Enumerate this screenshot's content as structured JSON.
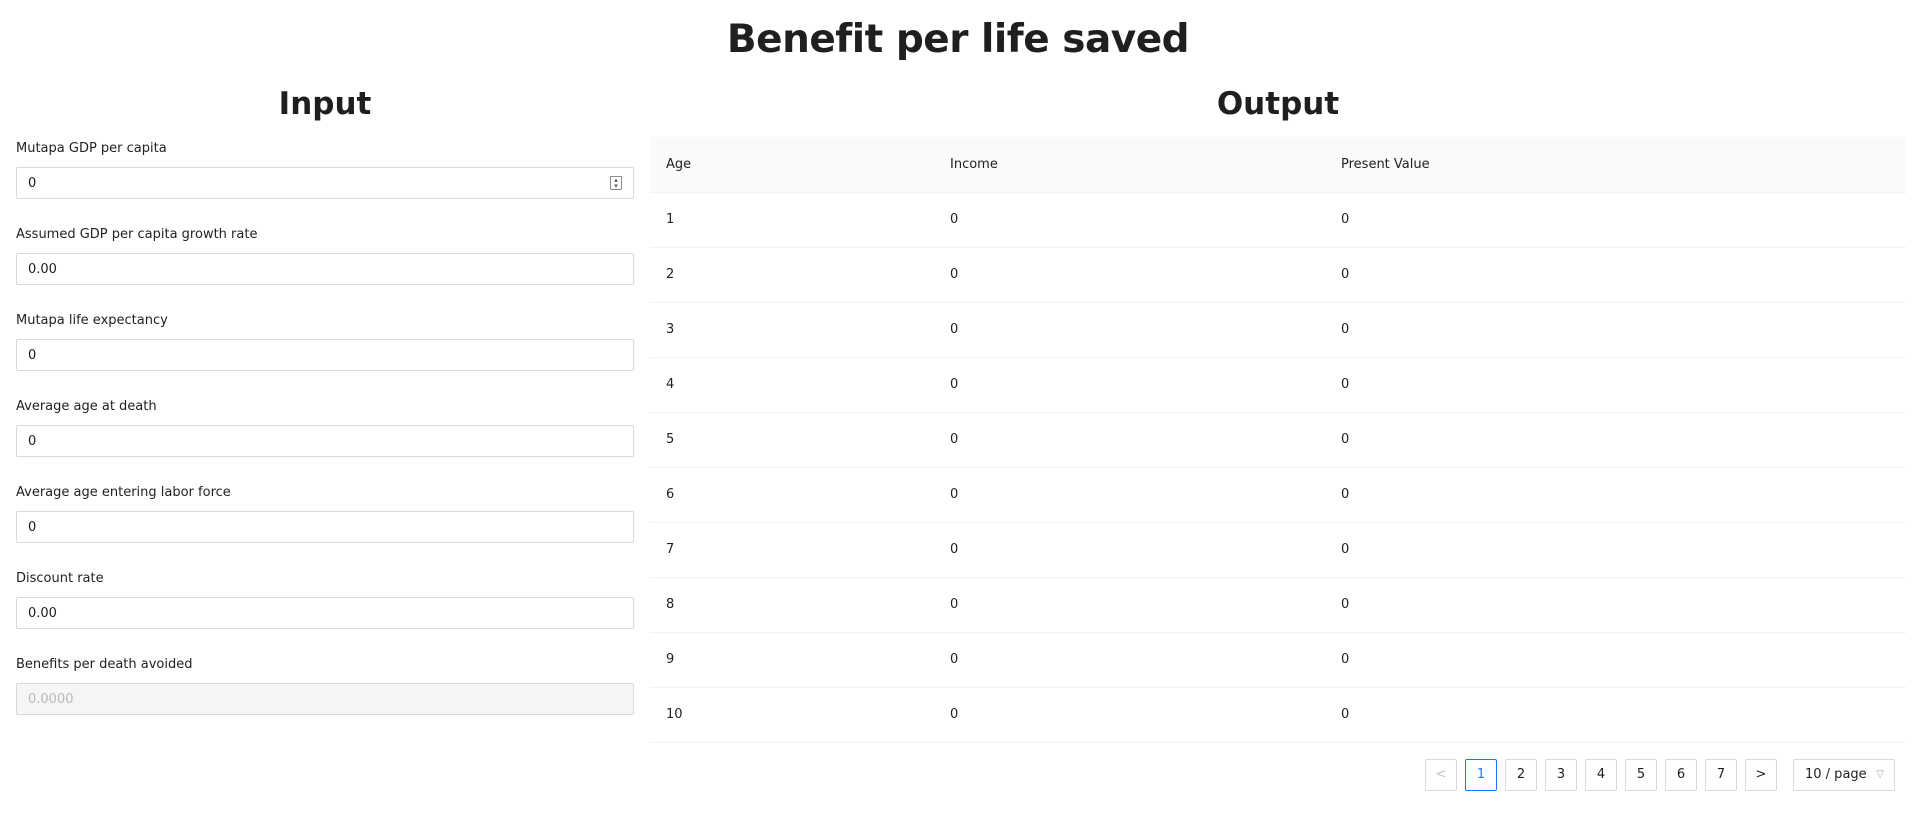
{
  "page": {
    "title": "Benefit per life saved",
    "input_title": "Input",
    "output_title": "Output"
  },
  "inputs": [
    {
      "label": "Mutapa GDP per capita",
      "value": "0",
      "icon": "number-stepper-icon",
      "disabled": false
    },
    {
      "label": "Assumed GDP per capita growth rate",
      "value": "0.00",
      "disabled": false
    },
    {
      "label": "Mutapa life expectancy",
      "value": "0",
      "disabled": false
    },
    {
      "label": "Average age at death",
      "value": "0",
      "disabled": false
    },
    {
      "label": "Average age entering labor force",
      "value": "0",
      "disabled": false
    },
    {
      "label": "Discount rate",
      "value": "0.00",
      "disabled": false
    },
    {
      "label": "Benefits per death avoided",
      "value": "0.0000",
      "disabled": true
    }
  ],
  "table": {
    "headers": [
      "Age",
      "Income",
      "Present Value"
    ],
    "rows": [
      [
        "1",
        "0",
        "0"
      ],
      [
        "2",
        "0",
        "0"
      ],
      [
        "3",
        "0",
        "0"
      ],
      [
        "4",
        "0",
        "0"
      ],
      [
        "5",
        "0",
        "0"
      ],
      [
        "6",
        "0",
        "0"
      ],
      [
        "7",
        "0",
        "0"
      ],
      [
        "8",
        "0",
        "0"
      ],
      [
        "9",
        "0",
        "0"
      ],
      [
        "10",
        "0",
        "0"
      ]
    ]
  },
  "pagination": {
    "prev": "<",
    "pages": [
      "1",
      "2",
      "3",
      "4",
      "5",
      "6",
      "7"
    ],
    "current": "1",
    "next": ">",
    "page_size": "10 / page",
    "accent_color": "#1677ff"
  }
}
